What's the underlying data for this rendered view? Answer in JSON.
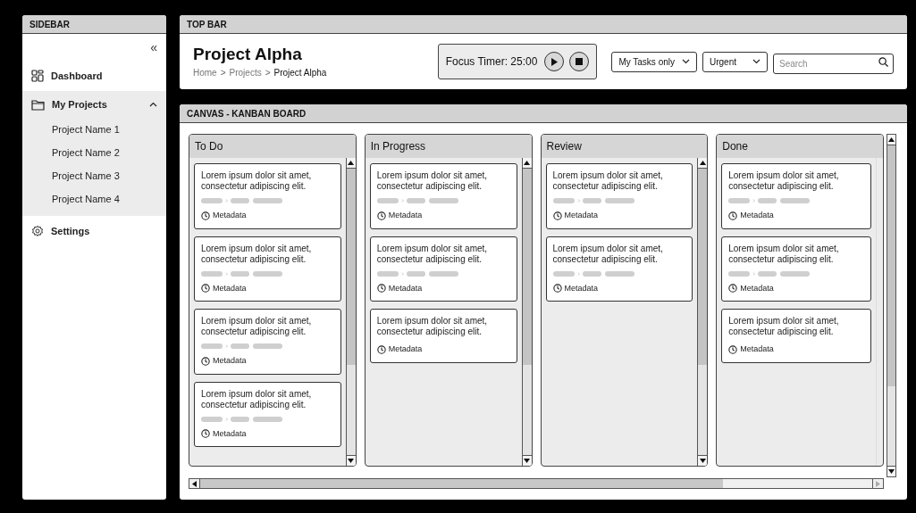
{
  "sidebar": {
    "header": "SIDEBAR",
    "collapse": "«",
    "items": [
      {
        "kind": "link",
        "label": "Dashboard"
      },
      {
        "kind": "group",
        "label": "My Projects",
        "expanded": true,
        "children": [
          {
            "label": "Project Name 1"
          },
          {
            "label": "Project Name 2"
          },
          {
            "label": "Project Name 3"
          },
          {
            "label": "Project Name 4"
          }
        ]
      },
      {
        "kind": "link",
        "label": "Settings"
      }
    ]
  },
  "top_bar": {
    "header": "TOP BAR",
    "title": "Project Alpha",
    "breadcrumb": [
      {
        "label": "Home",
        "current": false
      },
      {
        "label": "Projects",
        "current": false
      },
      {
        "label": "Project Alpha",
        "current": true
      }
    ],
    "separator": ">",
    "timer": {
      "label": "Focus Timer: 25:00"
    },
    "filters": [
      {
        "label": "My Tasks only"
      },
      {
        "label": "Urgent"
      }
    ],
    "search": {
      "placeholder": "Search"
    }
  },
  "canvas": {
    "header": "CANVAS - KANBAN BOARD",
    "columns": [
      {
        "title": "To Do",
        "scrollbar": true,
        "cards": [
          {
            "kind": "tagged",
            "text": "Lorem ipsum dolor sit amet, consectetur adipiscing elit.",
            "meta": "Metadata"
          },
          {
            "kind": "tagged",
            "text": "Lorem ipsum dolor sit amet, consectetur adipiscing elit.",
            "meta": "Metadata"
          },
          {
            "kind": "tagged",
            "text": "Lorem ipsum dolor sit amet, consectetur adipiscing elit.",
            "meta": "Metadata"
          },
          {
            "kind": "tagged",
            "text": "Lorem ipsum dolor sit amet, consectetur adipiscing elit.",
            "meta": "Metadata"
          }
        ]
      },
      {
        "title": "In Progress",
        "scrollbar": true,
        "cards": [
          {
            "kind": "tagged",
            "text": "Lorem ipsum dolor sit amet, consectetur adipiscing elit.",
            "meta": "Metadata"
          },
          {
            "kind": "tagged",
            "text": "Lorem ipsum dolor sit amet, consectetur adipiscing elit.",
            "meta": "Metadata"
          },
          {
            "kind": "plain",
            "text": "Lorem ipsum dolor sit amet, consectetur adipiscing elit.",
            "meta": "Metadata"
          }
        ]
      },
      {
        "title": "Review",
        "scrollbar": true,
        "cards": [
          {
            "kind": "tagged",
            "text": "Lorem ipsum dolor sit amet, consectetur adipiscing elit.",
            "meta": "Metadata"
          },
          {
            "kind": "tagged",
            "text": "Lorem ipsum dolor sit amet, consectetur adipiscing elit.",
            "meta": "Metadata"
          }
        ]
      },
      {
        "title": "Done",
        "scrollbar": false,
        "cards": [
          {
            "kind": "tagged",
            "text": "Lorem ipsum dolor sit amet, consectetur adipiscing elit.",
            "meta": "Metadata"
          },
          {
            "kind": "tagged",
            "text": "Lorem ipsum dolor sit amet, consectetur adipiscing elit.",
            "meta": "Metadata"
          },
          {
            "kind": "plain",
            "text": "Lorem ipsum dolor sit amet, consectetur adipiscing elit.",
            "meta": "Metadata"
          }
        ]
      }
    ]
  }
}
